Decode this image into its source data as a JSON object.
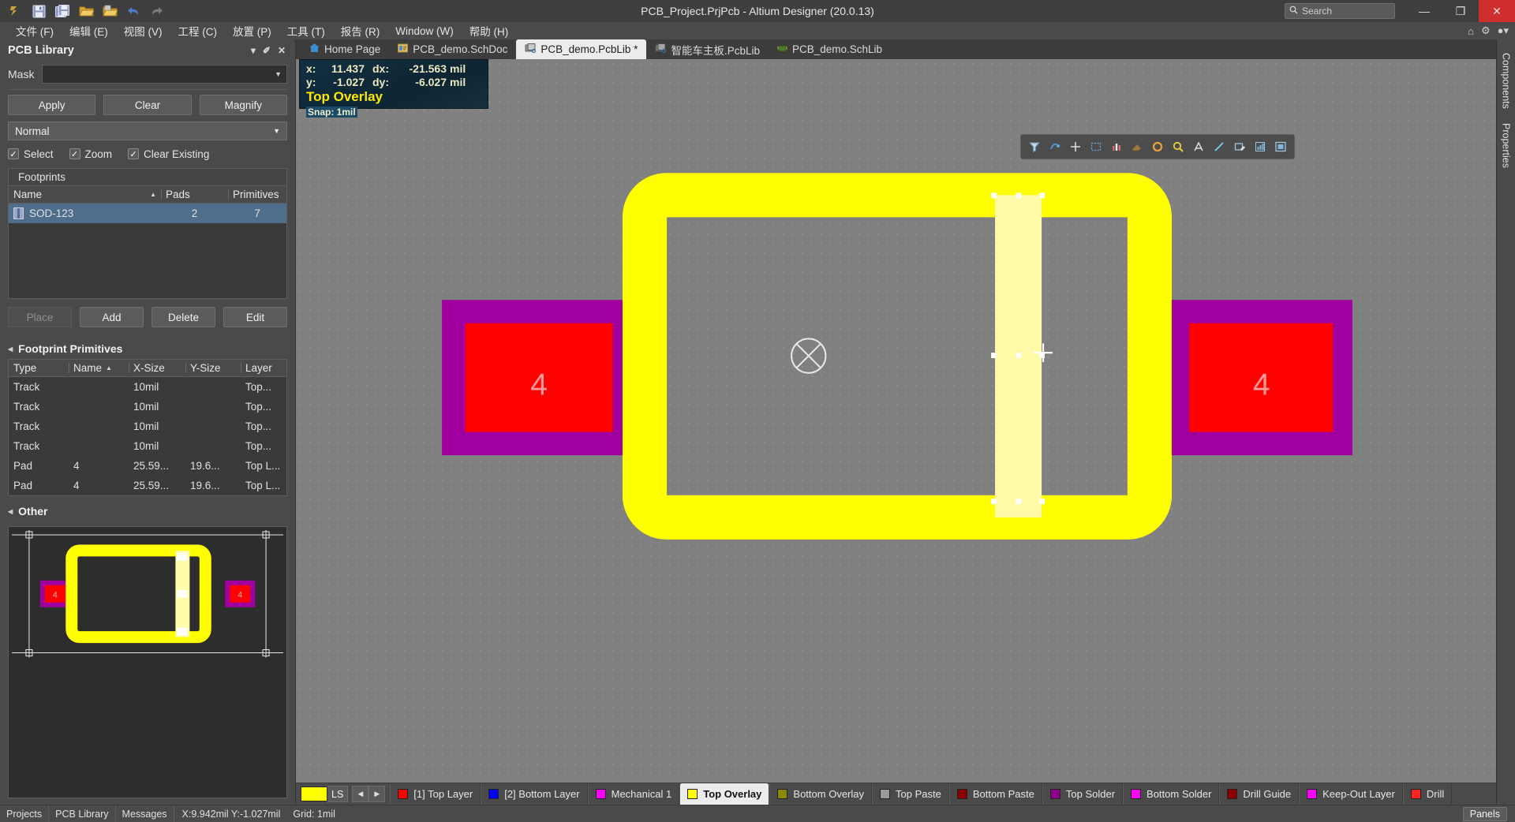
{
  "window": {
    "title": "PCB_Project.PrjPcb - Altium Designer (20.0.13)",
    "search_placeholder": "Search",
    "minimize": "—",
    "maximize": "❐",
    "close": "✕"
  },
  "quick_toolbar": [
    {
      "name": "altium-logo-icon",
      "label": "A"
    },
    {
      "name": "save-icon",
      "label": "Save"
    },
    {
      "name": "save-all-icon",
      "label": "Save All"
    },
    {
      "name": "open-folder-icon",
      "label": "Open"
    },
    {
      "name": "open-project-icon",
      "label": "Open Project"
    },
    {
      "name": "undo-icon",
      "label": "Undo"
    },
    {
      "name": "redo-icon",
      "label": "Redo"
    }
  ],
  "menubar": {
    "items": [
      {
        "label": "文件 (F)"
      },
      {
        "label": "编辑 (E)"
      },
      {
        "label": "视图 (V)"
      },
      {
        "label": "工程 (C)"
      },
      {
        "label": "放置 (P)"
      },
      {
        "label": "工具 (T)"
      },
      {
        "label": "报告 (R)"
      },
      {
        "label": "Window (W)"
      },
      {
        "label": "帮助 (H)"
      }
    ],
    "right_icons": [
      {
        "name": "home-icon",
        "glyph": "⌂"
      },
      {
        "name": "settings-gear-icon",
        "glyph": "⚙"
      },
      {
        "name": "user-account-icon",
        "glyph": "●▾"
      }
    ]
  },
  "panel": {
    "title": "PCB Library",
    "controls": [
      {
        "name": "panel-dropdown-icon",
        "glyph": "▾"
      },
      {
        "name": "panel-pin-icon",
        "glyph": "✐"
      },
      {
        "name": "panel-close-icon",
        "glyph": "✕"
      }
    ],
    "mask_label": "Mask",
    "mask_value": "",
    "mask_placeholder": "",
    "buttons": {
      "apply": "Apply",
      "clear": "Clear",
      "magnify": "Magnify"
    },
    "mode_select": "Normal",
    "checkboxes": [
      {
        "label": "Select",
        "checked": true
      },
      {
        "label": "Zoom",
        "checked": true
      },
      {
        "label": "Clear Existing",
        "checked": true
      }
    ],
    "footprints": {
      "caption": "Footprints",
      "columns": [
        "Name",
        "Pads",
        "Primitives"
      ],
      "sort_column": "Name",
      "rows": [
        {
          "name": "SOD-123",
          "pads": "2",
          "primitives": "7",
          "selected": true
        }
      ]
    },
    "list_buttons": {
      "place": "Place",
      "add": "Add",
      "delete": "Delete",
      "edit": "Edit"
    },
    "primitives": {
      "section_title": "Footprint Primitives",
      "columns": [
        "Type",
        "Name",
        "X-Size",
        "Y-Size",
        "Layer"
      ],
      "sort_column": "Name",
      "rows": [
        {
          "type": "Track",
          "name": "",
          "xsize": "10mil",
          "ysize": "",
          "layer": "Top..."
        },
        {
          "type": "Track",
          "name": "",
          "xsize": "10mil",
          "ysize": "",
          "layer": "Top..."
        },
        {
          "type": "Track",
          "name": "",
          "xsize": "10mil",
          "ysize": "",
          "layer": "Top..."
        },
        {
          "type": "Track",
          "name": "",
          "xsize": "10mil",
          "ysize": "",
          "layer": "Top..."
        },
        {
          "type": "Pad",
          "name": "4",
          "xsize": "25.59...",
          "ysize": "19.6...",
          "layer": "Top L..."
        },
        {
          "type": "Pad",
          "name": "4",
          "xsize": "25.59...",
          "ysize": "19.6...",
          "layer": "Top L..."
        }
      ]
    },
    "other": {
      "section_title": "Other"
    }
  },
  "tabs": [
    {
      "label": "Home Page",
      "icon": "home-icon",
      "active": false
    },
    {
      "label": "PCB_demo.SchDoc",
      "icon": "schematic-doc-icon",
      "active": false
    },
    {
      "label": "PCB_demo.PcbLib *",
      "icon": "pcblib-icon",
      "active": true
    },
    {
      "label": "智能车主板.PcbLib",
      "icon": "pcblib-icon",
      "active": false
    },
    {
      "label": "PCB_demo.SchLib",
      "icon": "schlib-icon",
      "active": false
    }
  ],
  "coordinates": {
    "x_label": "x:",
    "x_value": "11.437",
    "dx_label": "dx:",
    "dx_value": "-21.563",
    "x_unit": "mil",
    "y_label": "y:",
    "y_value": "-1.027",
    "dy_label": "dy:",
    "dy_value": "-6.027",
    "y_unit": "mil",
    "active_layer": "Top Overlay",
    "snap": "Snap: 1mil"
  },
  "canvas_toolbar": [
    {
      "name": "filter-icon"
    },
    {
      "name": "net-color-icon"
    },
    {
      "name": "crosshair-icon"
    },
    {
      "name": "select-area-icon"
    },
    {
      "name": "measure-icon"
    },
    {
      "name": "eraser-icon"
    },
    {
      "name": "orange-dot-icon"
    },
    {
      "name": "magnifier-icon"
    },
    {
      "name": "text-icon"
    },
    {
      "name": "line-icon"
    },
    {
      "name": "rectangle-edit-icon"
    },
    {
      "name": "chart-icon"
    },
    {
      "name": "board-view-icon"
    }
  ],
  "footprint_view": {
    "pad_label_left": "4",
    "pad_label_right": "4",
    "origin_marker": "origin-crosshair"
  },
  "layerbar": {
    "ls_label": "LS",
    "ls_color": "#ffff00",
    "prev_glyph": "◀",
    "next_glyph": "▶",
    "layers": [
      {
        "label": "[1] Top Layer",
        "color": "#ff0000",
        "active": false
      },
      {
        "label": "[2] Bottom Layer",
        "color": "#0000ff",
        "active": false
      },
      {
        "label": "Mechanical 1",
        "color": "#ff00ff",
        "active": false
      },
      {
        "label": "Top Overlay",
        "color": "#ffff00",
        "active": true
      },
      {
        "label": "Bottom Overlay",
        "color": "#8a8a00",
        "active": false
      },
      {
        "label": "Top Paste",
        "color": "#9a9a9a",
        "active": false
      },
      {
        "label": "Bottom Paste",
        "color": "#8b0000",
        "active": false
      },
      {
        "label": "Top Solder",
        "color": "#8b008b",
        "active": false
      },
      {
        "label": "Bottom Solder",
        "color": "#ff00ff",
        "active": false
      },
      {
        "label": "Drill Guide",
        "color": "#8b0000",
        "active": false
      },
      {
        "label": "Keep-Out Layer",
        "color": "#ff00ff",
        "active": false
      },
      {
        "label": "Drill",
        "color": "#ff2222",
        "active": false
      }
    ]
  },
  "statusbar": {
    "tabs": [
      {
        "label": "Projects"
      },
      {
        "label": "PCB Library"
      },
      {
        "label": "Messages"
      }
    ],
    "coords": "X:9.942mil Y:-1.027mil",
    "grid": "Grid: 1mil",
    "panels_button": "Panels"
  },
  "rightrail": [
    {
      "label": "Components"
    },
    {
      "label": "Properties"
    }
  ],
  "colors": {
    "accent_yellow": "#ffff00",
    "pad_red": "#ff0000",
    "solder_purple": "#a000a0",
    "canvas_gray": "#808080",
    "selection_blue": "#4e6e8c"
  }
}
